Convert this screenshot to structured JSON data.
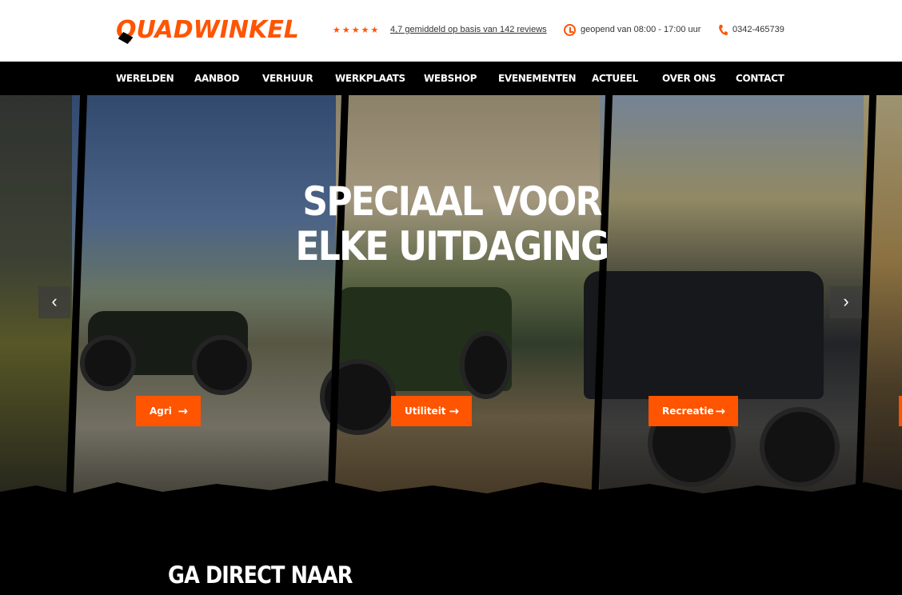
{
  "header": {
    "logo_text": "QUADWINKEL",
    "rating_stars": "★★★★★",
    "reviews_link": "4,7 gemiddeld op basis van 142 reviews",
    "opening_hours": "geopend van 08:00 - 17:00 uur",
    "phone": "0342-465739",
    "icons": {
      "hours": "clock-icon",
      "phone": "phone-icon"
    }
  },
  "nav": {
    "items": [
      {
        "label": "WERELDEN"
      },
      {
        "label": "AANBOD"
      },
      {
        "label": "VERHUUR"
      },
      {
        "label": "WERKPLAATS"
      },
      {
        "label": "WEBSHOP"
      },
      {
        "label": "EVENEMENTEN"
      },
      {
        "label": "ACTUEEL"
      },
      {
        "label": "OVER ONS"
      },
      {
        "label": "CONTACT"
      }
    ]
  },
  "hero": {
    "title": "SPECIAAL VOOR ELKE UITDAGING",
    "categories": [
      {
        "label": "Agri",
        "icon": "arrow-right-icon"
      },
      {
        "label": "Utiliteit",
        "icon": "arrow-right-icon"
      },
      {
        "label": "Recreatie",
        "icon": "arrow-right-icon"
      }
    ],
    "prev_icon": "‹",
    "next_icon": "›"
  },
  "section": {
    "title": "GA DIRECT NAAR"
  },
  "colors": {
    "accent": "#ff5400",
    "nav_bg": "#000000",
    "header_bg": "#ffffff"
  }
}
